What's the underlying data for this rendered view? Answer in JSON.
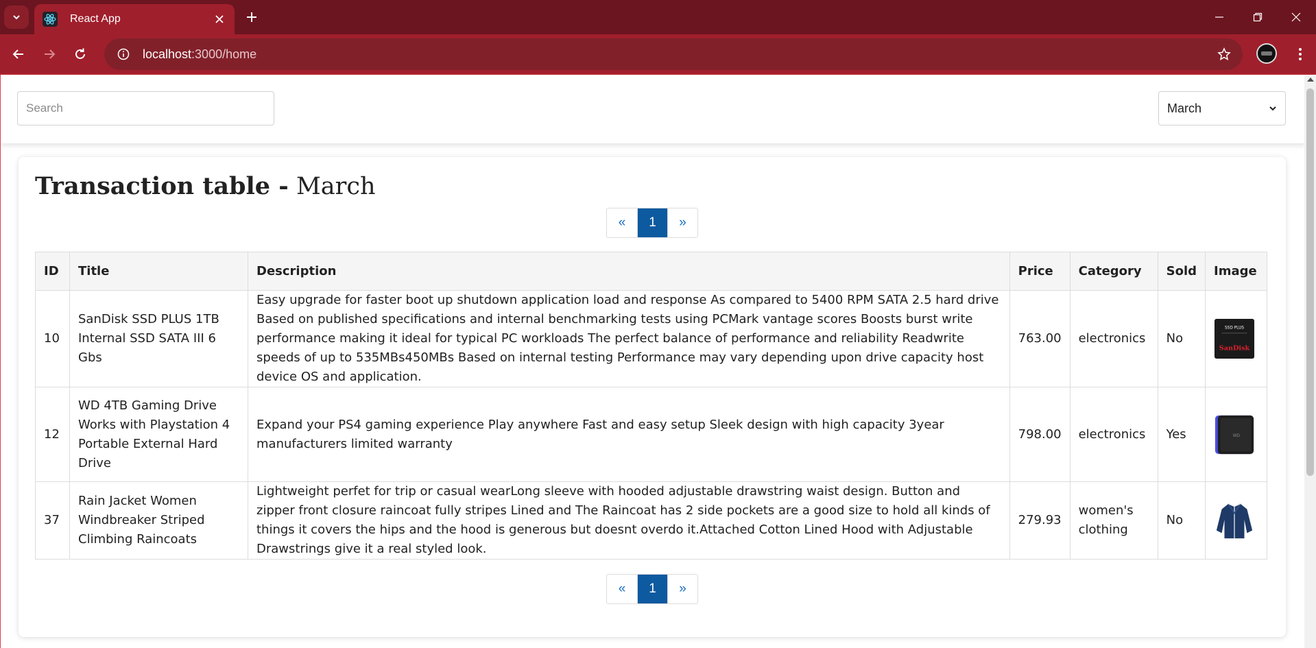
{
  "browser": {
    "tab_title": "React App",
    "url_host": "localhost",
    "url_path": ":3000/home"
  },
  "page": {
    "search_placeholder": "Search",
    "selected_month": "March",
    "title_prefix": "Transaction table -",
    "title_month": "March",
    "pagination": {
      "prev": "«",
      "current": "1",
      "next": "»"
    },
    "table": {
      "headers": [
        "ID",
        "Title",
        "Description",
        "Price",
        "Category",
        "Sold",
        "Image"
      ],
      "rows": [
        {
          "id": "10",
          "title": "SanDisk SSD PLUS 1TB Internal SSD SATA III 6 Gbs",
          "description": "Easy upgrade for faster boot up shutdown application load and response As compared to 5400 RPM SATA 2.5 hard drive Based on published specifications and internal benchmarking tests using PCMark vantage scores Boosts burst write performance making it ideal for typical PC workloads The perfect balance of performance and reliability Readwrite speeds of up to 535MBs450MBs Based on internal testing Performance may vary depending upon drive capacity host device OS and application.",
          "price": "763.00",
          "category": "electronics",
          "sold": "No",
          "image_icon": "ssd-product-image"
        },
        {
          "id": "12",
          "title": "WD 4TB Gaming Drive Works with Playstation 4 Portable External Hard Drive",
          "description": "Expand your PS4 gaming experience Play anywhere Fast and easy setup Sleek design with high capacity 3year manufacturers limited warranty",
          "price": "798.00",
          "category": "electronics",
          "sold": "Yes",
          "image_icon": "hard-drive-product-image"
        },
        {
          "id": "37",
          "title": "Rain Jacket Women Windbreaker Striped Climbing Raincoats",
          "description": "Lightweight perfet for trip or casual wearLong sleeve with hooded adjustable drawstring waist design. Button and zipper front closure raincoat fully stripes Lined and The Raincoat has 2 side pockets are a good size to hold all kinds of things it covers the hips and the hood is generous but doesnt overdo it.Attached Cotton Lined Hood with Adjustable Drawstrings give it a real styled look.",
          "price": "279.93",
          "category": "women's clothing",
          "sold": "No",
          "image_icon": "jacket-product-image"
        }
      ]
    }
  },
  "colors": {
    "chrome_dark": "#6b1520",
    "chrome_toolbar": "#a01f2c",
    "pagination_active": "#0d5aa0",
    "link_blue": "#1a6ec0"
  }
}
